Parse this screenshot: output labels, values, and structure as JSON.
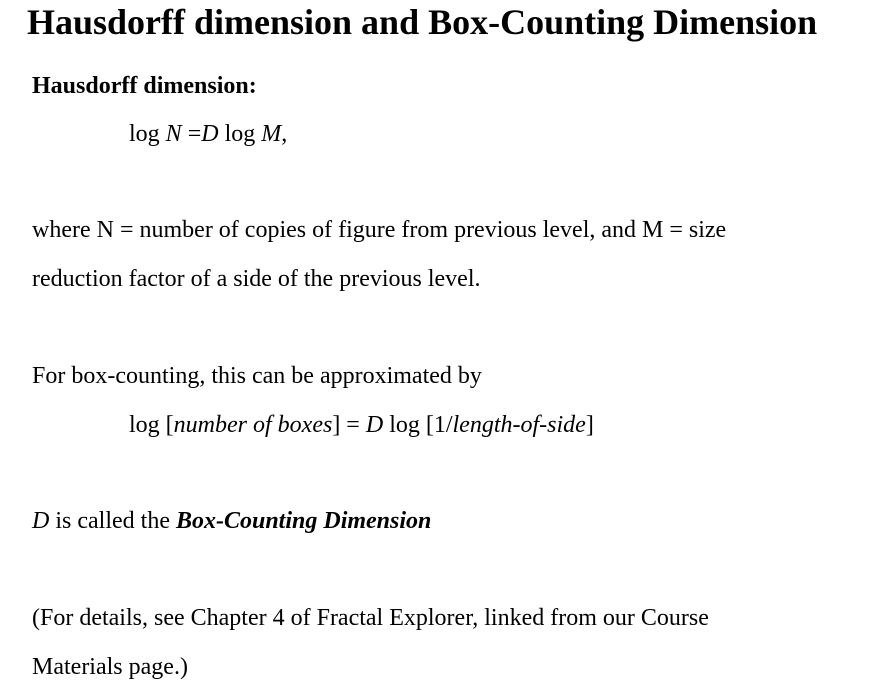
{
  "title": "Hausdorff dimension and Box-Counting Dimension",
  "hausdorff": {
    "heading": "Hausdorff dimension:",
    "formula": {
      "log1": "log ",
      "N": "N",
      "eq": " =",
      "D": "D",
      "log2": " log ",
      "M": "M",
      "end": ","
    },
    "explanation_line1": "where N = number of copies of figure from previous level, and M = size",
    "explanation_line2": "reduction factor of a side of the previous level."
  },
  "box_counting": {
    "intro": "For box-counting, this can be approximated by",
    "formula": {
      "log1": "log  [",
      "boxes": "number of boxes",
      "mid": "] = ",
      "D": "D",
      "log2": " log [1/",
      "side": "length-of-side",
      "end": "]"
    },
    "definition": {
      "D": "D",
      "text": " is called the ",
      "term": "Box-Counting Dimension"
    }
  },
  "note": {
    "line1": "(For details, see Chapter 4 of Fractal Explorer, linked from our Course",
    "line2": "Materials page.)"
  }
}
